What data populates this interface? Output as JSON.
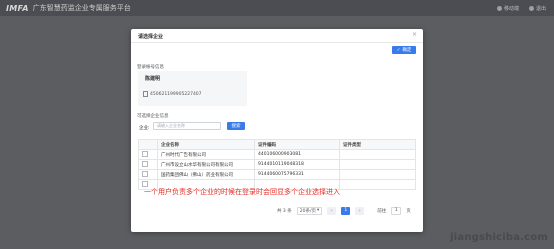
{
  "header": {
    "logo_text": "IMFA",
    "platform_title": "广东智慧药监企业专属服务平台",
    "right_items": [
      "移动端",
      "退出"
    ]
  },
  "modal": {
    "title": "请选择企业",
    "close_glyph": "×",
    "confirm_label": "确定",
    "login_section_label": "登录帐号信息",
    "user": {
      "name": "陈建明",
      "id_number": "450621199905227407"
    },
    "company_section_label": "可选择企业信息",
    "search_label": "企业:",
    "search_placeholder": "请输入企业名称",
    "query_label": "搜索",
    "table": {
      "headers": [
        "企业名称",
        "证件编码",
        "证件类型"
      ],
      "rows": [
        [
          "广州时代广告有限公司",
          "440106000903081",
          ""
        ],
        [
          "广州市设立山水华有限公司有限公司",
          "9144010119048318",
          ""
        ],
        [
          "国药集团佛山（佛山）药业有限公司",
          "9144060075796331",
          ""
        ],
        [
          "",
          "",
          ""
        ]
      ]
    },
    "annotation": "一个用户负责多个企业的时候在登录时会回显多个企业选择进入",
    "pagination": {
      "total": "共 3 条",
      "page_size": "20条/页",
      "prev": "‹",
      "current": "1",
      "next": "›",
      "goto_label": "前往",
      "goto_value": "1",
      "page_suffix": "页"
    }
  },
  "watermark": "jiangshiciba.com",
  "colors": {
    "primary": "#3a7bea",
    "annotation_red": "#e3302a",
    "overlay": "#5b5d61"
  }
}
